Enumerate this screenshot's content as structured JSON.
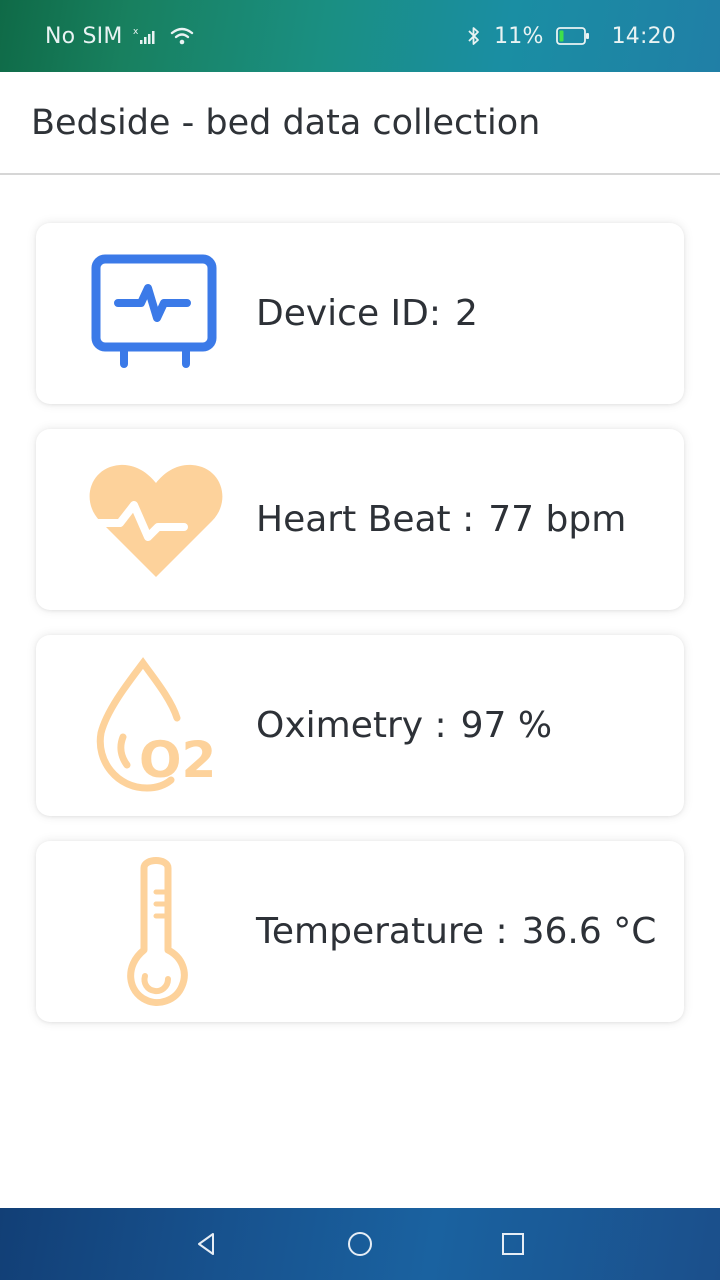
{
  "status_bar": {
    "carrier": "No SIM",
    "battery": "11%",
    "time": "14:20",
    "icons": [
      "signal-icon",
      "wifi-icon",
      "bluetooth-icon",
      "battery-icon"
    ]
  },
  "header": {
    "title": "Bedside - bed data collection"
  },
  "cards": [
    {
      "label": "Device ID:",
      "value": "2",
      "icon": "monitor-pulse-icon",
      "icon_color": "#3b7ae8"
    },
    {
      "label": "Heart Beat :",
      "value": "77 bpm",
      "icon": "heart-icon",
      "icon_color": "#fdd29b"
    },
    {
      "label": "Oximetry :",
      "value": "97 %",
      "icon": "oxygen-drop-icon",
      "icon_color": "#fdd29b"
    },
    {
      "label": "Temperature :",
      "value": "36.6 °C",
      "icon": "thermometer-icon",
      "icon_color": "#fdd29b"
    }
  ],
  "nav_bar": {
    "buttons": [
      "back-button",
      "home-button",
      "recents-button"
    ]
  }
}
